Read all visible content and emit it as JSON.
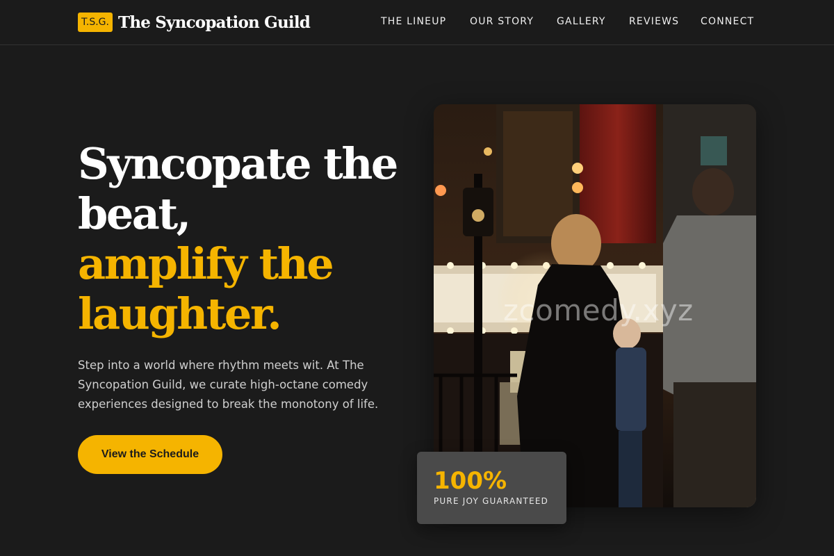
{
  "brand": {
    "badge": "T.S.G.",
    "name": "The Syncopation Guild"
  },
  "nav": {
    "items": [
      "THE LINEUP",
      "OUR STORY",
      "GALLERY",
      "REVIEWS",
      "CONNECT"
    ]
  },
  "hero": {
    "headline_white_1": "Syncopate the",
    "headline_white_2": "beat,",
    "headline_yellow_1": "amplify the",
    "headline_yellow_2": "laughter.",
    "description": "Step into a world where rhythm meets wit. At The Syncopation Guild, we curate high-octane comedy experiences designed to break the monotony of life.",
    "cta_label": "View the Schedule"
  },
  "photo": {
    "watermark": "zcomedy.xyz"
  },
  "stat": {
    "value": "100%",
    "label": "PURE JOY GUARANTEED"
  },
  "colors": {
    "background": "#1b1b1b",
    "accent": "#f5b400",
    "text": "#ffffff",
    "muted_text": "#cfcfcf",
    "card": "#4a4a4a"
  }
}
